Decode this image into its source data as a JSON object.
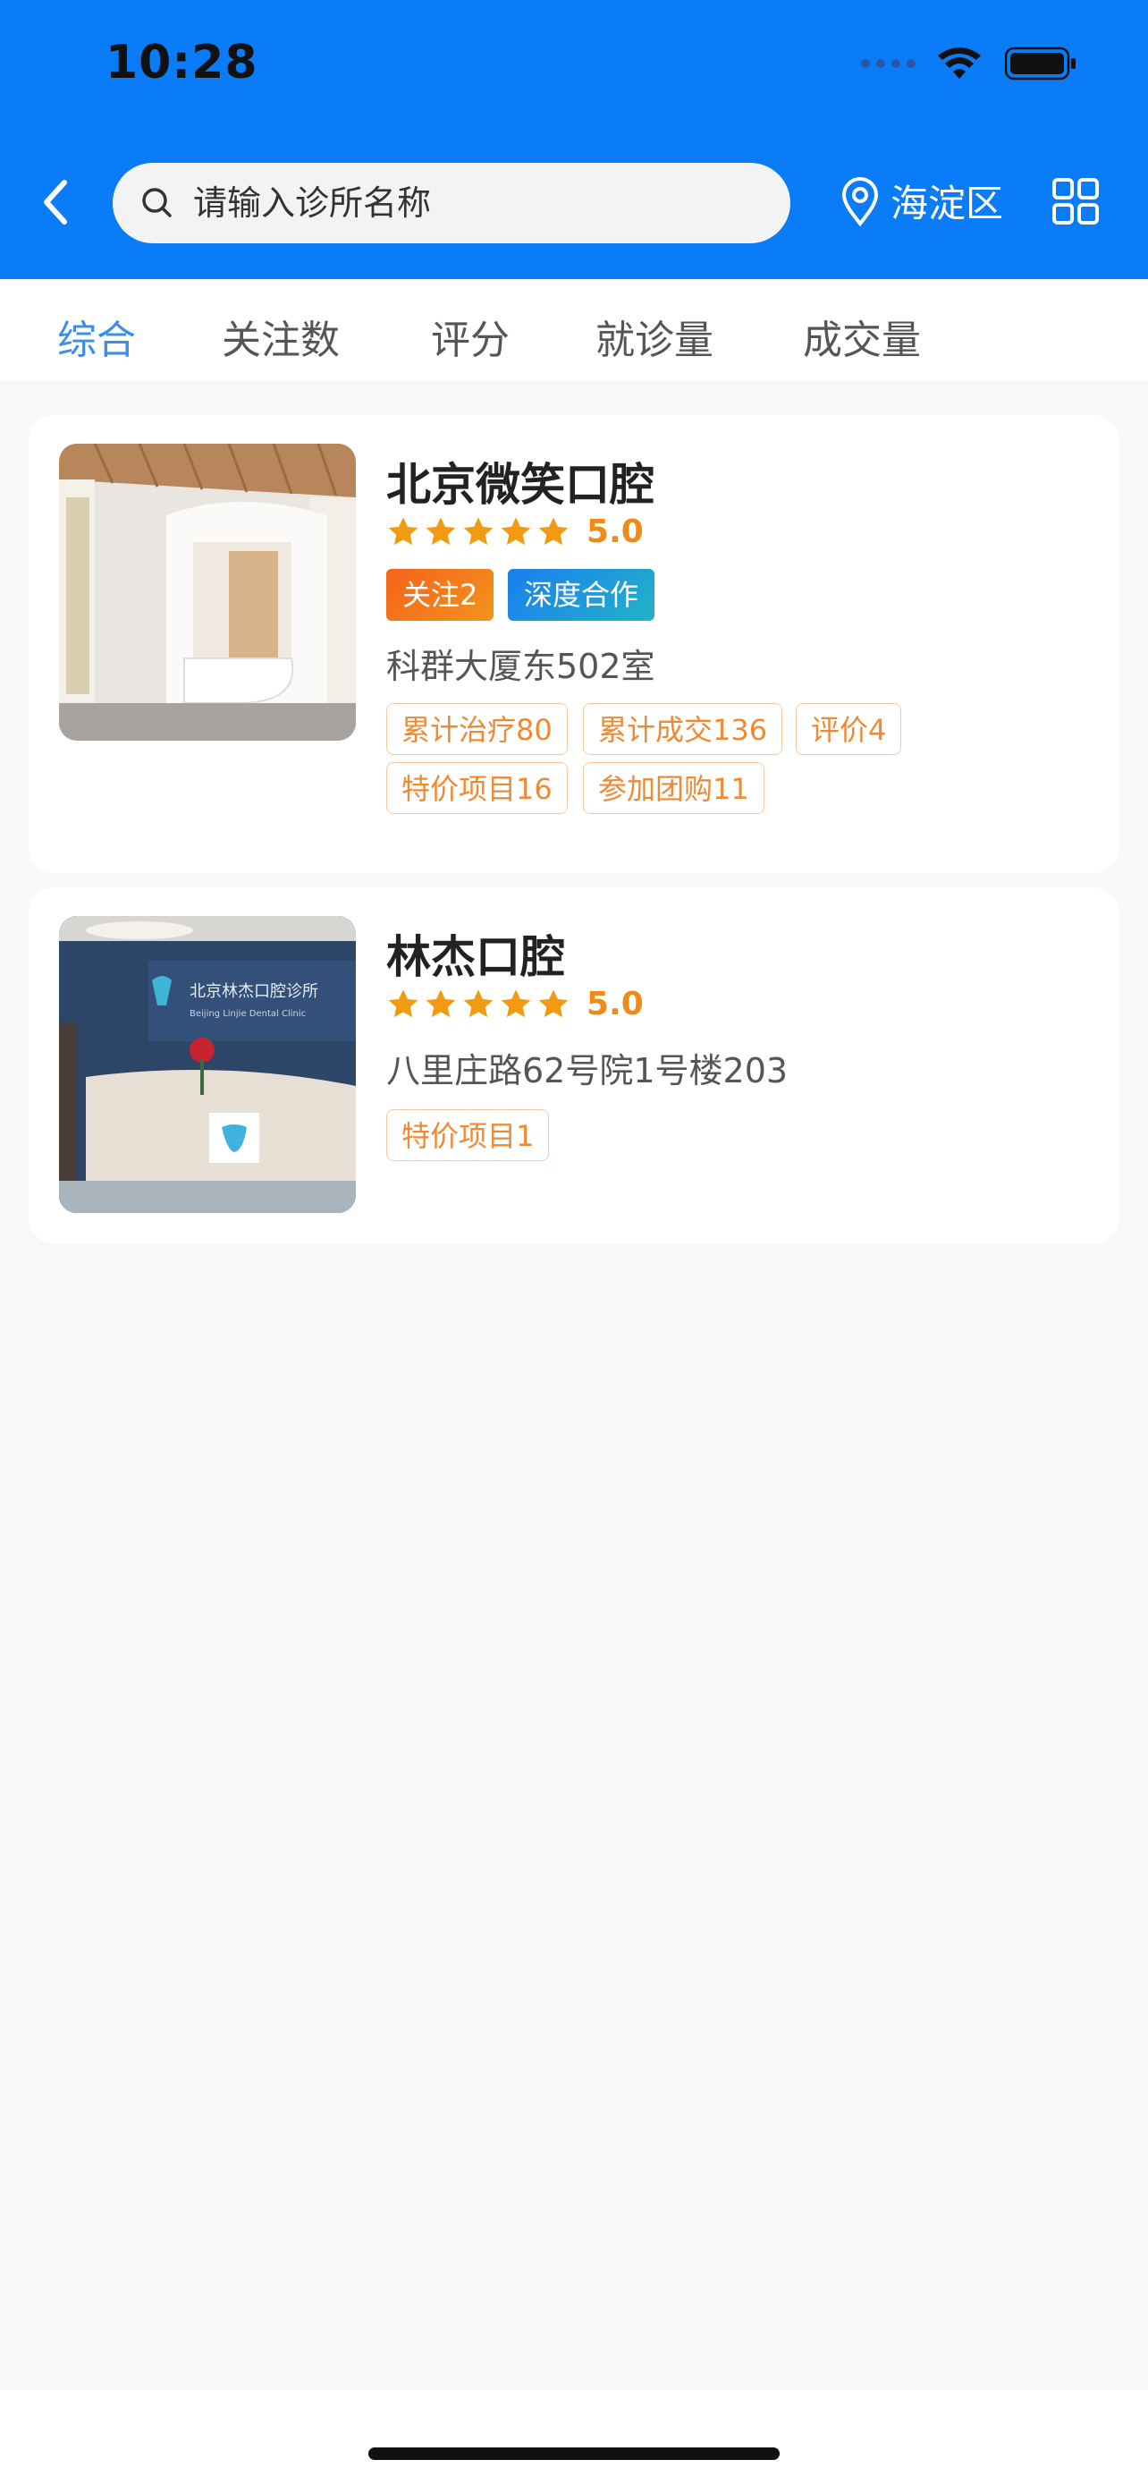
{
  "status_bar": {
    "time": "10:28"
  },
  "header": {
    "search_placeholder": "请输入诊所名称",
    "location": "海淀区"
  },
  "tabs": [
    {
      "label": "综合",
      "active": true
    },
    {
      "label": "关注数",
      "active": false
    },
    {
      "label": "评分",
      "active": false
    },
    {
      "label": "就诊量",
      "active": false
    },
    {
      "label": "成交量",
      "active": false
    }
  ],
  "clinics": [
    {
      "name": "北京微笑口腔",
      "stars": 5,
      "rating": "5.0",
      "badges": [
        "关注2",
        "深度合作"
      ],
      "address": "科群大厦东502室",
      "tags": [
        "累计治疗80",
        "累计成交136",
        "评价4",
        "特价项目16",
        "参加团购11"
      ]
    },
    {
      "name": "林杰口腔",
      "stars": 5,
      "rating": "5.0",
      "badges": [],
      "address": "八里庄路62号院1号楼203",
      "tags": [
        "特价项目1"
      ],
      "sign_text": "北京林杰口腔诊所",
      "sign_subtext": "Beijing Linjie Dental Clinic"
    }
  ],
  "colors": {
    "header_bg": "#0a7cf7",
    "tab_active": "#3d8ee6",
    "star": "#f29a12",
    "tag_text": "#ef8a34"
  }
}
